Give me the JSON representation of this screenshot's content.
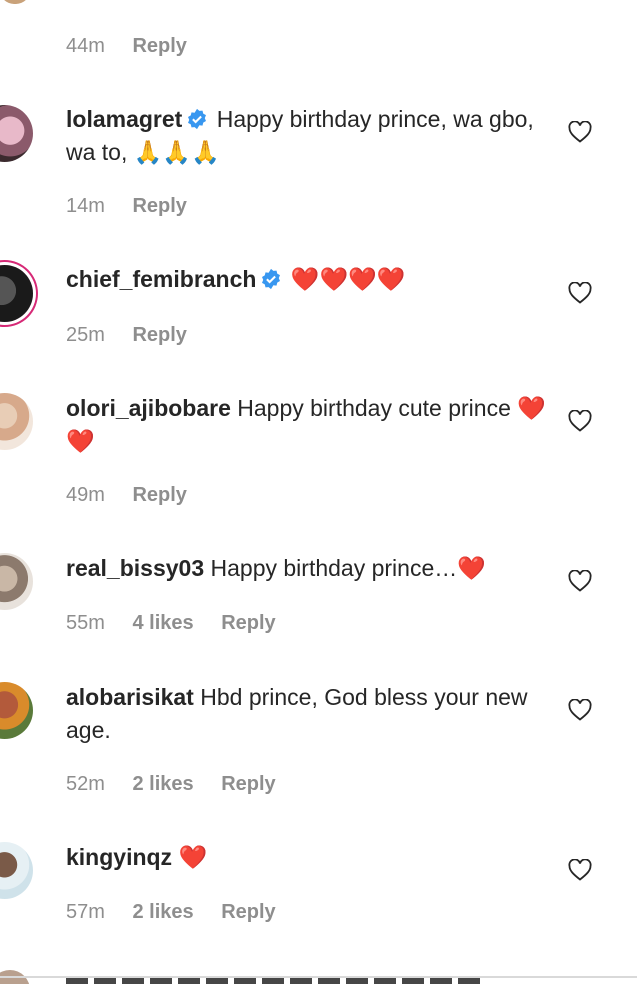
{
  "top_meta": {
    "time": "44m",
    "reply": "Reply"
  },
  "comments": [
    {
      "user": "lolamagret",
      "verified": true,
      "text": "Happy birthday prince, wa gbo, wa to, 🙏🙏🙏",
      "time": "14m",
      "likes": "",
      "reply": "Reply"
    },
    {
      "user": "chief_femibranch",
      "verified": true,
      "text": "❤️❤️❤️❤️",
      "time": "25m",
      "likes": "",
      "reply": "Reply"
    },
    {
      "user": "olori_ajibobare",
      "verified": false,
      "text": "Happy birthday cute prince ❤️❤️",
      "time": "49m",
      "likes": "",
      "reply": "Reply"
    },
    {
      "user": "real_bissy03",
      "verified": false,
      "text": "Happy birthday prince…❤️",
      "time": "55m",
      "likes": "4 likes",
      "reply": "Reply"
    },
    {
      "user": "alobarisikat",
      "verified": false,
      "text": "Hbd prince, God bless your new age.",
      "time": "52m",
      "likes": "2 likes",
      "reply": "Reply"
    },
    {
      "user": "kingyinqz",
      "verified": false,
      "text": "❤️",
      "time": "57m",
      "likes": "2 likes",
      "reply": "Reply"
    }
  ],
  "icons": {
    "like": "heart-outline-icon",
    "verified": "verified-badge-icon"
  },
  "colors": {
    "verified": "#3897f0",
    "meta": "#8e8e8e",
    "heart": "#e0245e",
    "text": "#262626"
  }
}
